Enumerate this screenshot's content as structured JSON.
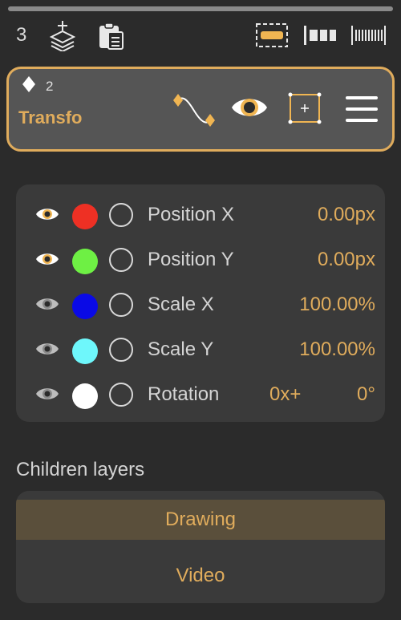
{
  "toolbar": {
    "layer_count": "3",
    "icons": [
      "add-layer-icon",
      "clipboard-icon",
      "selection-rect-icon",
      "column-view-icon",
      "timeline-ruler-icon"
    ]
  },
  "layer": {
    "keyframe_count": "2",
    "name": "Transfo",
    "icons": [
      "curve-keyframes-icon",
      "eye-icon",
      "bounding-box-icon",
      "menu-icon"
    ],
    "accent_color": "#e0ac5c"
  },
  "properties": [
    {
      "label": "Position X",
      "value": "0.00px",
      "color": "#ee3024",
      "visible_highlight": true
    },
    {
      "label": "Position Y",
      "value": "0.00px",
      "color": "#6ef044",
      "visible_highlight": true
    },
    {
      "label": "Scale X",
      "value": "100.00%",
      "color": "#0a0ae6",
      "visible_highlight": false
    },
    {
      "label": "Scale Y",
      "value": "100.00%",
      "color": "#6ef7fb",
      "visible_highlight": false
    },
    {
      "label": "Rotation",
      "extra": "0x+",
      "value": "0°",
      "color": "#ffffff",
      "visible_highlight": false
    }
  ],
  "children": {
    "heading": "Children layers",
    "items": [
      {
        "label": "Drawing",
        "selected": true
      },
      {
        "label": "Video",
        "selected": false
      }
    ]
  }
}
